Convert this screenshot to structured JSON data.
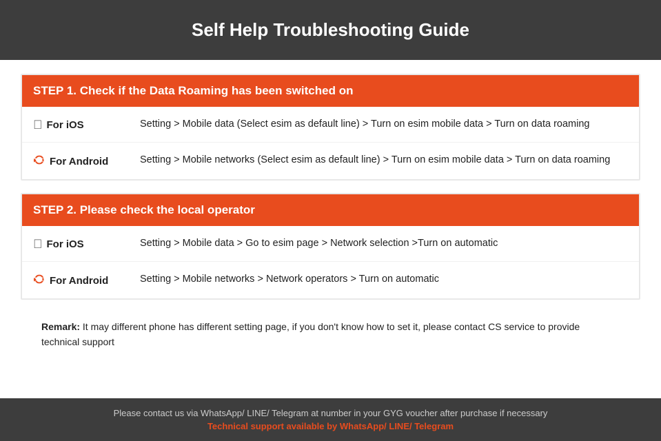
{
  "header": {
    "title": "Self Help Troubleshooting Guide"
  },
  "step1": {
    "header": "STEP 1.  Check if the Data Roaming has been switched on",
    "ios_label": "For iOS",
    "ios_instruction": "Setting > Mobile data (Select esim as default line) > Turn on esim mobile data > Turn on data roaming",
    "android_label": "For Android",
    "android_instruction": "Setting > Mobile networks (Select esim as default line) > Turn on esim mobile data > Turn on data roaming"
  },
  "step2": {
    "header": "STEP 2.  Please check the local operator",
    "ios_label": "For iOS",
    "ios_instruction": "Setting > Mobile data > Go to esim page > Network selection >Turn on automatic",
    "android_label": "For Android",
    "android_instruction": "Setting > Mobile networks > Network operators > Turn on automatic"
  },
  "remark": {
    "label": "Remark:",
    "text": " It may different phone has different setting page, if you don't know how to set it,  please contact CS service to provide technical support"
  },
  "footer": {
    "main_text": "Please contact us via WhatsApp/ LINE/ Telegram at number in your GYG voucher after purchase if necessary",
    "support_text": "Technical support available by WhatsApp/ LINE/ Telegram"
  },
  "icons": {
    "apple": "",
    "android": "🤖"
  }
}
